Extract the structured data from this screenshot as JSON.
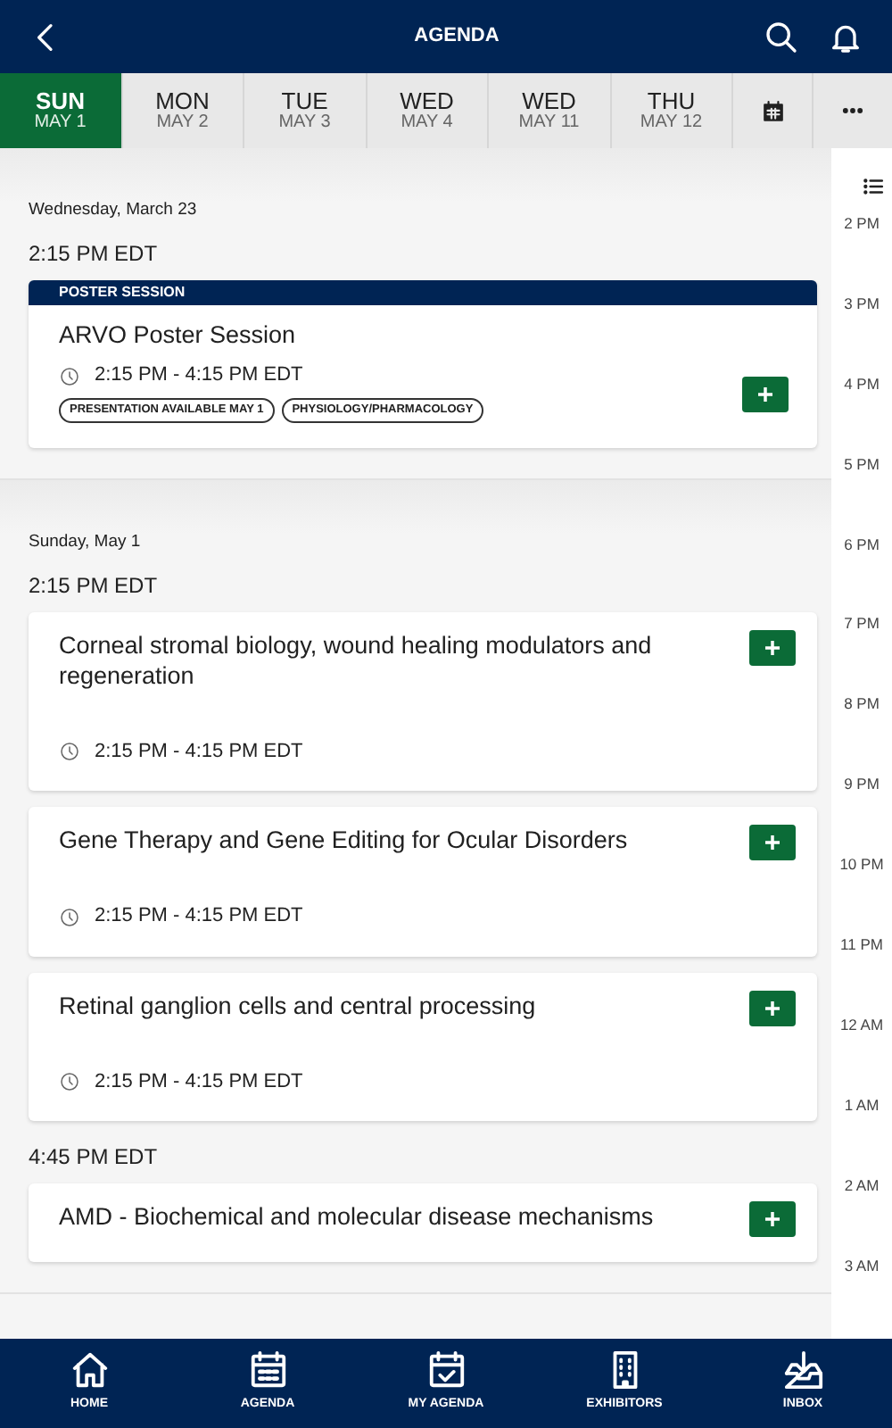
{
  "header": {
    "title": "AGENDA"
  },
  "days": [
    {
      "day": "SUN",
      "date": "MAY 1",
      "selected": true
    },
    {
      "day": "MON",
      "date": "MAY 2",
      "selected": false
    },
    {
      "day": "TUE",
      "date": "MAY 3",
      "selected": false
    },
    {
      "day": "WED",
      "date": "MAY 4",
      "selected": false
    },
    {
      "day": "WED",
      "date": "MAY 11",
      "selected": false
    },
    {
      "day": "THU",
      "date": "MAY 12",
      "selected": false
    }
  ],
  "timeline": [
    "2 PM",
    "3 PM",
    "4 PM",
    "5 PM",
    "6 PM",
    "7 PM",
    "8 PM",
    "9 PM",
    "10 PM",
    "11 PM",
    "12 AM",
    "1 AM",
    "2 AM",
    "3 AM"
  ],
  "sections": [
    {
      "date": "Wednesday, March 23",
      "groups": [
        {
          "time": "2:15 PM EDT",
          "sessions": [
            {
              "kind": "poster",
              "category": "POSTER SESSION",
              "title": "ARVO Poster Session",
              "time": "2:15 PM - 4:15 PM EDT",
              "tags": [
                "PRESENTATION AVAILABLE MAY 1",
                "PHYSIOLOGY/PHARMACOLOGY"
              ]
            }
          ]
        }
      ]
    },
    {
      "date": "Sunday, May 1",
      "groups": [
        {
          "time": "2:15 PM EDT",
          "sessions": [
            {
              "kind": "standard",
              "title": "Corneal stromal biology, wound healing modulators and regeneration",
              "time": "2:15 PM - 4:15 PM EDT"
            },
            {
              "kind": "standard",
              "title": "Gene Therapy and Gene Editing for Ocular Disorders",
              "time": "2:15 PM - 4:15 PM EDT"
            },
            {
              "kind": "standard",
              "title": "Retinal ganglion cells and central processing",
              "time": "2:15 PM - 4:15 PM EDT"
            }
          ]
        },
        {
          "time": "4:45 PM EDT",
          "sessions": [
            {
              "kind": "standard",
              "title": "AMD - Biochemical and molecular disease mechanisms"
            }
          ]
        }
      ]
    }
  ],
  "bottom_nav": [
    {
      "kind": "home",
      "label": "HOME"
    },
    {
      "kind": "agenda",
      "label": "AGENDA"
    },
    {
      "kind": "my-agenda",
      "label": "MY AGENDA"
    },
    {
      "kind": "exhibitors",
      "label": "EXHIBITORS"
    },
    {
      "kind": "inbox",
      "label": "INBOX"
    }
  ]
}
